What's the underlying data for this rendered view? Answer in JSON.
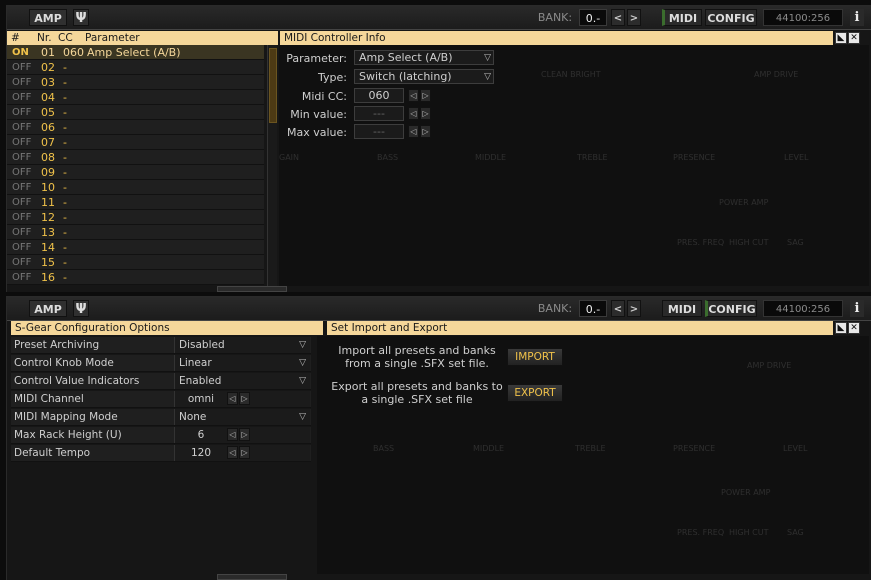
{
  "toolbar": {
    "amp_label": "AMP",
    "plug_icon": "Ψ",
    "bank_label": "BANK:",
    "bank_value": "0.-",
    "prev_icon": "<",
    "next_icon": ">",
    "midi_label": "MIDI",
    "config_label": "CONFIG",
    "sample_rate": "44100:256",
    "info_icon": "i"
  },
  "midi_list": {
    "headers": {
      "hash": "#",
      "nr": "Nr.",
      "cc": "CC",
      "param": "Parameter"
    },
    "rows": [
      {
        "state": "ON",
        "nr": "01",
        "cc": "060",
        "param": "Amp Select (A/B)"
      },
      {
        "state": "OFF",
        "nr": "02",
        "cc": "-",
        "param": ""
      },
      {
        "state": "OFF",
        "nr": "03",
        "cc": "-",
        "param": ""
      },
      {
        "state": "OFF",
        "nr": "04",
        "cc": "-",
        "param": ""
      },
      {
        "state": "OFF",
        "nr": "05",
        "cc": "-",
        "param": ""
      },
      {
        "state": "OFF",
        "nr": "06",
        "cc": "-",
        "param": ""
      },
      {
        "state": "OFF",
        "nr": "07",
        "cc": "-",
        "param": ""
      },
      {
        "state": "OFF",
        "nr": "08",
        "cc": "-",
        "param": ""
      },
      {
        "state": "OFF",
        "nr": "09",
        "cc": "-",
        "param": ""
      },
      {
        "state": "OFF",
        "nr": "10",
        "cc": "-",
        "param": ""
      },
      {
        "state": "OFF",
        "nr": "11",
        "cc": "-",
        "param": ""
      },
      {
        "state": "OFF",
        "nr": "12",
        "cc": "-",
        "param": ""
      },
      {
        "state": "OFF",
        "nr": "13",
        "cc": "-",
        "param": ""
      },
      {
        "state": "OFF",
        "nr": "14",
        "cc": "-",
        "param": ""
      },
      {
        "state": "OFF",
        "nr": "15",
        "cc": "-",
        "param": ""
      },
      {
        "state": "OFF",
        "nr": "16",
        "cc": "-",
        "param": ""
      }
    ]
  },
  "midi_info": {
    "title": "MIDI Controller Info",
    "parameter_label": "Parameter:",
    "parameter_value": "Amp Select (A/B)",
    "type_label": "Type:",
    "type_value": "Switch (latching)",
    "midi_cc_label": "Midi CC:",
    "midi_cc_value": "060",
    "min_label": "Min value:",
    "min_value": "---",
    "max_label": "Max value:",
    "max_value": "---",
    "dropdown_icon": "▽",
    "stepper_left": "◁",
    "stepper_right": "▷",
    "corner_icon": "◣",
    "close_icon": "✕"
  },
  "amp_faint_labels": {
    "clean_bright": "CLEAN BRIGHT",
    "amp_drive": "AMP DRIVE",
    "gain": "GAIN",
    "bass": "BASS",
    "middle": "MIDDLE",
    "treble": "TREBLE",
    "presence": "PRESENCE",
    "level": "LEVEL",
    "power_amp": "POWER AMP",
    "pres_freq": "PRES. FREQ",
    "high_cut": "HIGH CUT",
    "sag": "SAG"
  },
  "config": {
    "title": "S-Gear Configuration Options",
    "rows": [
      {
        "key": "Preset Archiving",
        "value": "Disabled",
        "kind": "dropdown"
      },
      {
        "key": "Control Knob Mode",
        "value": "Linear",
        "kind": "dropdown"
      },
      {
        "key": "Control Value Indicators",
        "value": "Enabled",
        "kind": "dropdown"
      },
      {
        "key": "MIDI Channel",
        "value": "omni",
        "kind": "stepper"
      },
      {
        "key": "MIDI Mapping Mode",
        "value": "None",
        "kind": "dropdown"
      },
      {
        "key": "Max Rack Height (U)",
        "value": "6",
        "kind": "stepper"
      },
      {
        "key": "Default Tempo",
        "value": "120",
        "kind": "stepper"
      }
    ]
  },
  "import_export": {
    "title": "Set Import and Export",
    "import_text_1": "Import all presets and banks",
    "import_text_2": "from a single .SFX set file.",
    "import_label": "IMPORT",
    "export_text_1": "Export all presets and banks to",
    "export_text_2": "a single .SFX set file",
    "export_label": "EXPORT"
  }
}
